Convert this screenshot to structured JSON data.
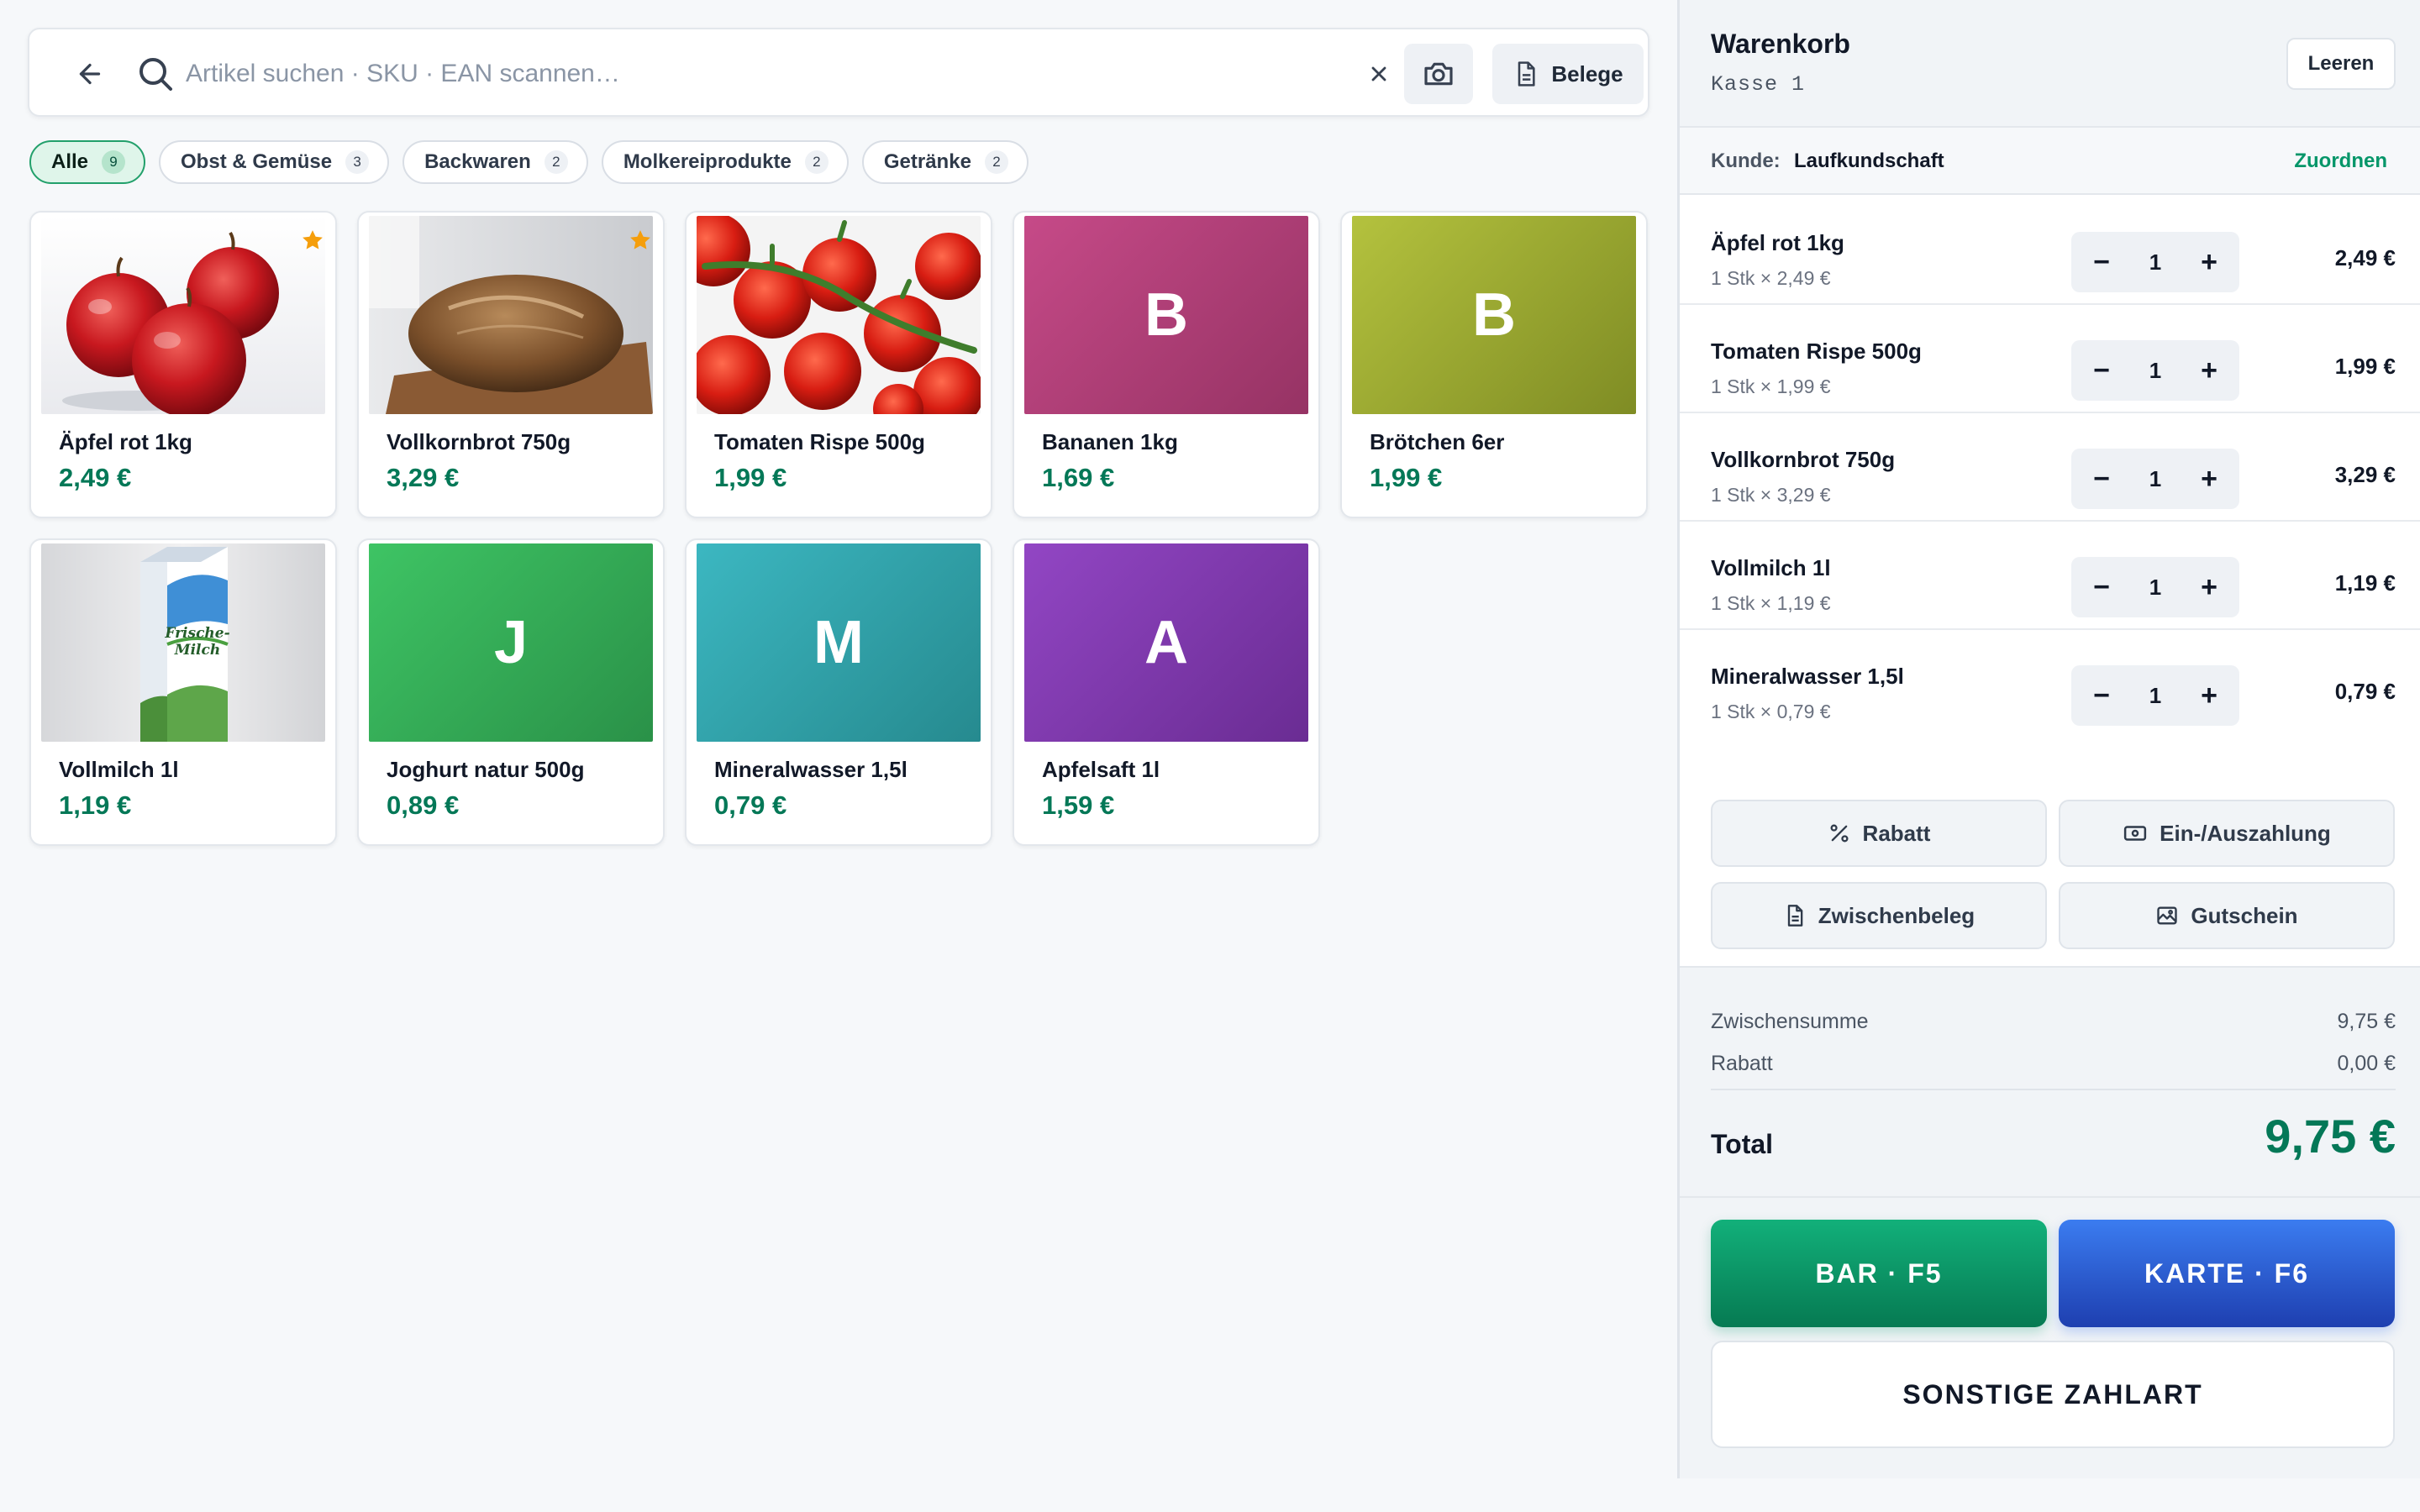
{
  "search": {
    "placeholder": "Artikel suchen · SKU · EAN scannen…",
    "receipts_label": "Belege"
  },
  "categories": [
    {
      "label": "Alle",
      "count": "9",
      "active": true
    },
    {
      "label": "Obst & Gemüse",
      "count": "3"
    },
    {
      "label": "Backwaren",
      "count": "2"
    },
    {
      "label": "Molkereiprodukte",
      "count": "2"
    },
    {
      "label": "Getränke",
      "count": "2"
    }
  ],
  "products": [
    {
      "name": "Äpfel rot 1kg",
      "price": "2,49 €",
      "image": "apples-photo",
      "favorite": true
    },
    {
      "name": "Vollkornbrot 750g",
      "price": "3,29 €",
      "image": "bread-photo",
      "favorite": true
    },
    {
      "name": "Tomaten Rispe 500g",
      "price": "1,99 €",
      "image": "tomatoes-photo"
    },
    {
      "name": "Bananen 1kg",
      "price": "1,69 €",
      "initial": "B",
      "color": "#b13d78"
    },
    {
      "name": "Brötchen 6er",
      "price": "1,99 €",
      "initial": "B",
      "color": "#9aaa2e"
    },
    {
      "name": "Vollmilch 1l",
      "price": "1,19 €",
      "image": "milk-photo",
      "pack_text": "Frische-Milch"
    },
    {
      "name": "Joghurt natur 500g",
      "price": "0,89 €",
      "initial": "J",
      "color": "#2fa852"
    },
    {
      "name": "Mineralwasser 1,5l",
      "price": "0,79 €",
      "initial": "M",
      "color": "#2fa0a6"
    },
    {
      "name": "Apfelsaft 1l",
      "price": "1,59 €",
      "initial": "A",
      "color": "#7c39a8"
    }
  ],
  "cart": {
    "title": "Warenkorb",
    "register": "Kasse 1",
    "clear_label": "Leeren",
    "customer_label": "Kunde:",
    "customer_name": "Laufkundschaft",
    "assign_label": "Zuordnen",
    "lines": [
      {
        "name": "Äpfel rot 1kg",
        "detail": "1 Stk × 2,49 €",
        "qty": "1",
        "total": "2,49 €"
      },
      {
        "name": "Tomaten Rispe 500g",
        "detail": "1 Stk × 1,99 €",
        "qty": "1",
        "total": "1,99 €"
      },
      {
        "name": "Vollkornbrot 750g",
        "detail": "1 Stk × 3,29 €",
        "qty": "1",
        "total": "3,29 €"
      },
      {
        "name": "Vollmilch 1l",
        "detail": "1 Stk × 1,19 €",
        "qty": "1",
        "total": "1,19 €"
      },
      {
        "name": "Mineralwasser 1,5l",
        "detail": "1 Stk × 0,79 €",
        "qty": "1",
        "total": "0,79 €"
      }
    ],
    "actions": {
      "discount": "Rabatt",
      "cash_in_out": "Ein-/Auszahlung",
      "interim_receipt": "Zwischenbeleg",
      "voucher": "Gutschein"
    },
    "totals": {
      "subtotal_label": "Zwischensumme",
      "subtotal": "9,75 €",
      "discount_label": "Rabatt",
      "discount": "0,00 €",
      "total_label": "Total",
      "total": "9,75 €"
    },
    "payment": {
      "cash": "BAR · F5",
      "card": "KARTE · F6",
      "other": "SONSTIGE ZAHLART"
    }
  },
  "colors": {
    "accent": "#047857",
    "cash": "#0a9a68",
    "card": "#2d5fd6",
    "favorite": "#f59e0b"
  }
}
